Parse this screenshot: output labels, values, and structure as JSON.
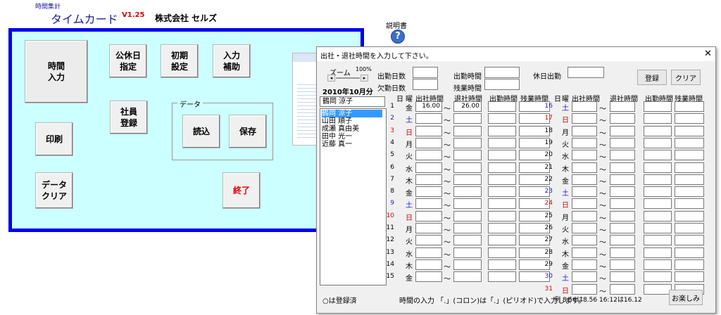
{
  "header": {
    "small_title": "時間集計",
    "title": "タイムカード",
    "version": "V1.25",
    "company": "株式会社  セルズ",
    "manual_label": "説明書",
    "help_icon": "?"
  },
  "menu": {
    "time_input": "時間\n入力",
    "holiday": "公休日\n指定",
    "initial": "初期\n設定",
    "input_assist": "入力\n補助",
    "employee_register": "社員\n登録",
    "print": "印刷",
    "data_group": "データ",
    "load": "読込",
    "save": "保存",
    "data_clear": "データ\nクリア",
    "exit": "終了"
  },
  "dialog": {
    "title": "出社・退社時間を入力して下さい。",
    "zoom_label": "ズーム",
    "zoom_value": "100%",
    "period": "2010年10月分",
    "work_days_label": "出勤日数",
    "absent_days_label": "欠勤日数",
    "work_time_label": "出勤時間",
    "overtime_label": "残業時間",
    "holiday_work_label": "休日出勤",
    "register_btn": "登録",
    "clear_btn": "クリア",
    "selected_employee": "鶴岡 涼子",
    "employees": [
      "鶴岡 涼子",
      "山田 順子",
      "成瀬 真由美",
      "田中 光一",
      "近藤 真一"
    ],
    "col_headers": {
      "day": "日",
      "dow": "曜",
      "in": "出社時間",
      "out": "退社時間",
      "work": "出勤時間",
      "over": "残業時間"
    },
    "days_left": [
      {
        "d": "1",
        "w": "金",
        "in": "16.00",
        "out": "26.00"
      },
      {
        "d": "2",
        "w": "土",
        "in": "",
        "out": ""
      },
      {
        "d": "3",
        "w": "日",
        "in": "",
        "out": ""
      },
      {
        "d": "4",
        "w": "月",
        "in": "",
        "out": ""
      },
      {
        "d": "5",
        "w": "火",
        "in": "",
        "out": ""
      },
      {
        "d": "6",
        "w": "水",
        "in": "",
        "out": ""
      },
      {
        "d": "7",
        "w": "木",
        "in": "",
        "out": ""
      },
      {
        "d": "8",
        "w": "金",
        "in": "",
        "out": ""
      },
      {
        "d": "9",
        "w": "土",
        "in": "",
        "out": ""
      },
      {
        "d": "10",
        "w": "日",
        "in": "",
        "out": ""
      },
      {
        "d": "11",
        "w": "月",
        "in": "",
        "out": ""
      },
      {
        "d": "12",
        "w": "火",
        "in": "",
        "out": ""
      },
      {
        "d": "13",
        "w": "水",
        "in": "",
        "out": ""
      },
      {
        "d": "14",
        "w": "木",
        "in": "",
        "out": ""
      },
      {
        "d": "15",
        "w": "金",
        "in": "",
        "out": ""
      }
    ],
    "days_right": [
      {
        "d": "16",
        "w": "土"
      },
      {
        "d": "17",
        "w": "日"
      },
      {
        "d": "18",
        "w": "月"
      },
      {
        "d": "19",
        "w": "火"
      },
      {
        "d": "20",
        "w": "水"
      },
      {
        "d": "21",
        "w": "木"
      },
      {
        "d": "22",
        "w": "金"
      },
      {
        "d": "23",
        "w": "土"
      },
      {
        "d": "24",
        "w": "日"
      },
      {
        "d": "25",
        "w": "月"
      },
      {
        "d": "26",
        "w": "火"
      },
      {
        "d": "27",
        "w": "水"
      },
      {
        "d": "28",
        "w": "木"
      },
      {
        "d": "29",
        "w": "金"
      },
      {
        "d": "30",
        "w": "土"
      },
      {
        "d": "31",
        "w": "日"
      }
    ],
    "registered_note": "○は登録済",
    "instruction": "時間の入力 「.」(コロン)は「.」(ピリオド)で入力します。",
    "example": "例  8:56は8.56  16:12は16.12",
    "fun_btn": "お楽しみ"
  },
  "colors": {
    "panel_bg": "#ccffff",
    "panel_border": "#0000ee",
    "saturday": "#1a1ad0",
    "sunday": "#e00000",
    "selection": "#3399ff"
  }
}
